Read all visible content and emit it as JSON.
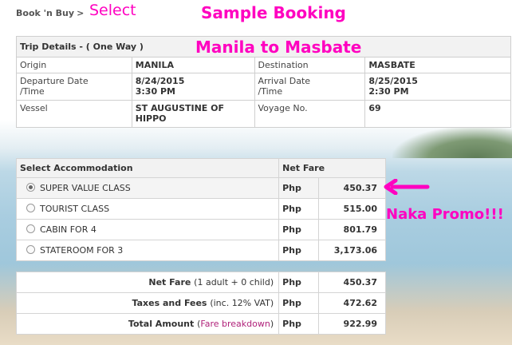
{
  "breadcrumb": {
    "root": "Book 'n Buy",
    "separator": ">",
    "current": "Select"
  },
  "annotations": {
    "title": "Sample Booking",
    "route": "Manila to Masbate",
    "promo": "Naka Promo!!!",
    "color": "#ff00c0"
  },
  "trip": {
    "header": "Trip Details - ( One Way )",
    "origin_label": "Origin",
    "origin": "MANILA",
    "destination_label": "Destination",
    "destination": "MASBATE",
    "departure_label_1": "Departure Date",
    "departure_label_2": "/Time",
    "departure_date": "8/24/2015",
    "departure_time": "3:30 PM",
    "arrival_label_1": "Arrival Date",
    "arrival_label_2": "/Time",
    "arrival_date": "8/25/2015",
    "arrival_time": "2:30 PM",
    "vessel_label": "Vessel",
    "vessel_1": "ST AUGUSTINE OF",
    "vessel_2": "HIPPO",
    "voyage_label": "Voyage No.",
    "voyage": "69"
  },
  "accommodation": {
    "header": "Select Accommodation",
    "fare_header": "Net Fare",
    "options": [
      {
        "name": "SUPER VALUE CLASS",
        "currency": "Php",
        "fare": "450.37",
        "selected": true
      },
      {
        "name": "TOURIST CLASS",
        "currency": "Php",
        "fare": "515.00",
        "selected": false
      },
      {
        "name": "CABIN FOR 4",
        "currency": "Php",
        "fare": "801.79",
        "selected": false
      },
      {
        "name": "STATEROOM FOR 3",
        "currency": "Php",
        "fare": "3,173.06",
        "selected": false
      }
    ]
  },
  "summary": {
    "net_fare_label": "Net Fare",
    "net_fare_note": "(1 adult + 0 child)",
    "net_fare_currency": "Php",
    "net_fare": "450.37",
    "taxes_label": "Taxes and Fees",
    "taxes_note": "(inc. 12% VAT)",
    "taxes_currency": "Php",
    "taxes": "472.62",
    "total_label": "Total Amount",
    "total_link_open": "(",
    "total_link": "Fare breakdown",
    "total_link_close": ")",
    "total_currency": "Php",
    "total": "922.99"
  }
}
